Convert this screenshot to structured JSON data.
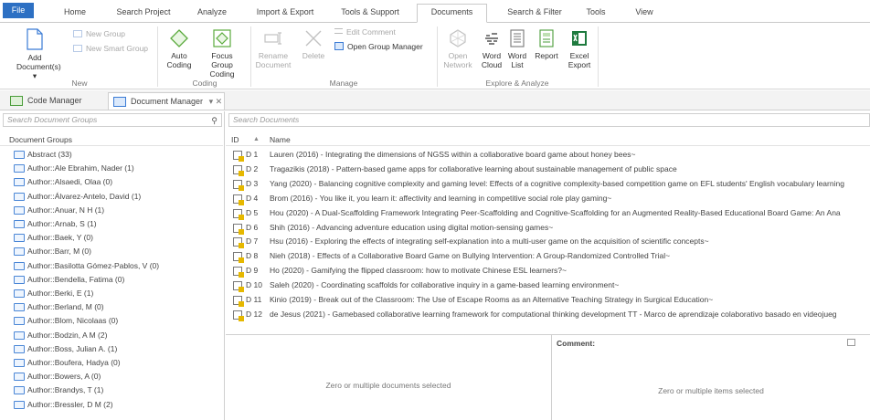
{
  "ribbon_tabs": [
    "File",
    "Home",
    "Search Project",
    "Analyze",
    "Import & Export",
    "Tools & Support",
    "Documents",
    "Search & Filter",
    "Tools",
    "View"
  ],
  "ribbon": {
    "add_documents": "Add Document(s) ▾",
    "new_group": "New Group",
    "new_smart_group": "New Smart Group",
    "group_new": "New",
    "auto_coding": "Auto Coding",
    "focus_group_coding": "Focus Group Coding",
    "group_coding": "Coding",
    "rename_document": "Rename Document",
    "delete": "Delete",
    "edit_comment": "Edit Comment",
    "open_group_manager": "Open Group Manager",
    "group_manage": "Manage",
    "open_network": "Open Network",
    "word_cloud": "Word Cloud",
    "word_list": "Word List",
    "report": "Report",
    "excel_export": "Excel Export",
    "group_explore": "Explore & Analyze"
  },
  "panel_tabs": {
    "code_manager": "Code Manager",
    "document_manager": "Document Manager",
    "doc_manager_controls": "▾ ✕"
  },
  "left_panel": {
    "search_placeholder": "Search Document Groups",
    "column_header": "Document Groups",
    "groups": [
      "Abstract (33)",
      "Author::Ale Ebrahim, Nader (1)",
      "Author::Alsaedi, Olaa (0)",
      "Author::Álvarez-Antelo, David (1)",
      "Author::Anuar, N H (1)",
      "Author::Arnab, S (1)",
      "Author::Baek, Y (0)",
      "Author::Barr, M (0)",
      "Author::Basilotta Gómez-Pablos, V (0)",
      "Author::Bendella, Fatima (0)",
      "Author::Berki, E (1)",
      "Author::Berland, M (0)",
      "Author::Blom, Nicolaas (0)",
      "Author::Bodzin, A M (2)",
      "Author::Boss, Julian A. (1)",
      "Author::Boufera, Hadya (0)",
      "Author::Bowers, A (0)",
      "Author::Brandys, T (1)",
      "Author::Bressler, D M (2)"
    ]
  },
  "right_panel": {
    "search_placeholder": "Search Documents",
    "col_id": "ID",
    "col_sort": "▲",
    "col_name": "Name",
    "documents": [
      {
        "id": "D 1",
        "name": "Lauren (2016) - Integrating the dimensions of NGSS within a collaborative board game about honey bees~"
      },
      {
        "id": "D 2",
        "name": "Tragazikis (2018) - Pattern-based game apps for collaborative learning about sustainable management of public space"
      },
      {
        "id": "D 3",
        "name": "Yang (2020) - Balancing cognitive complexity and gaming level: Effects of a cognitive complexity-based competition game on EFL students' English vocabulary learning"
      },
      {
        "id": "D 4",
        "name": "Brom (2016) - You like it, you learn it: affectivity and learning in competitive social role play gaming~"
      },
      {
        "id": "D 5",
        "name": "Hou (2020) - A Dual-Scaffolding Framework Integrating Peer-Scaffolding and Cognitive-Scaffolding for an Augmented Reality-Based Educational Board Game: An Ana"
      },
      {
        "id": "D 6",
        "name": "Shih (2016) - Advancing adventure education using digital motion-sensing games~"
      },
      {
        "id": "D 7",
        "name": "Hsu (2016) - Exploring the effects of integrating self-explanation into a multi-user game on the acquisition of scientific concepts~"
      },
      {
        "id": "D 8",
        "name": "Nieh (2018) - Effects of a Collaborative Board Game on Bullying Intervention: A Group-Randomized Controlled Trial~"
      },
      {
        "id": "D 9",
        "name": "Ho (2020) - Gamifying the flipped classroom: how to motivate Chinese ESL learners?~"
      },
      {
        "id": "D 10",
        "name": "Saleh (2020) - Coordinating scaffolds for collaborative inquiry in a game-based learning environment~"
      },
      {
        "id": "D 11",
        "name": "Kinio (2019) - Break out of the Classroom: The Use of Escape Rooms as an Alternative Teaching Strategy in Surgical Education~"
      },
      {
        "id": "D 12",
        "name": "de Jesus (2021) - Gamebased collaborative learning framework for computational thinking development TT - Marco de aprendizaje colaborativo basado en videojueg"
      }
    ],
    "left_empty": "Zero or multiple documents selected",
    "comment_label": "Comment:",
    "right_empty": "Zero or multiple items selected"
  }
}
